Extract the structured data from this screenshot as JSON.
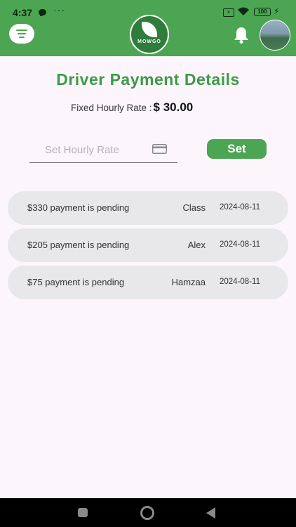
{
  "status_bar": {
    "time": "4:37",
    "dots": "···",
    "battery": "100"
  },
  "header": {
    "logo_text": "MOWGO"
  },
  "page": {
    "title": "Driver Payment Details",
    "rate_label": "Fixed Hourly Rate :",
    "rate_value": "$ 30.00"
  },
  "rate_form": {
    "input_value": "",
    "placeholder": "Set Hourly Rate",
    "set_label": "Set"
  },
  "payments": [
    {
      "text": "$330 payment is pending",
      "name": "Class",
      "date": "2024-08-11"
    },
    {
      "text": "$205 payment is pending",
      "name": "Alex",
      "date": "2024-08-11"
    },
    {
      "text": "$75 payment is pending",
      "name": "Hamzaa",
      "date": "2024-08-11"
    }
  ],
  "colors": {
    "brand_green": "#4ca552",
    "title_green": "#3d9b47",
    "background": "#fcf6fc",
    "card_gray": "#e8e8ea"
  }
}
